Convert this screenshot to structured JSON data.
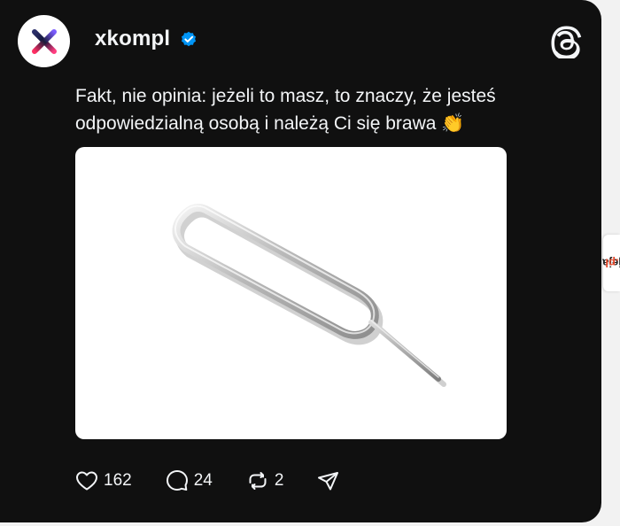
{
  "post": {
    "username": "xkompl",
    "verified": true,
    "text_line1": "Fakt, nie opinia: jeżeli to masz, to znaczy, że jesteś",
    "text_line2": "odpowiedzialną osobą i należą Ci się brawa",
    "emoji": "👏",
    "image_subject": "sim-ejector-tool"
  },
  "actions": {
    "likes": "162",
    "replies": "24",
    "reposts": "2"
  },
  "watermark": {
    "text_main": "jeja",
    "text_accent": ".pl"
  },
  "colors": {
    "card_bg": "#101010",
    "text": "#f3f5f7",
    "verified_badge": "#0095f6",
    "watermark_accent": "#e8492b"
  },
  "icons": [
    "x-logo-avatar",
    "verified-badge-icon",
    "threads-logo-icon",
    "heart-icon",
    "comment-icon",
    "repost-icon",
    "share-icon"
  ]
}
